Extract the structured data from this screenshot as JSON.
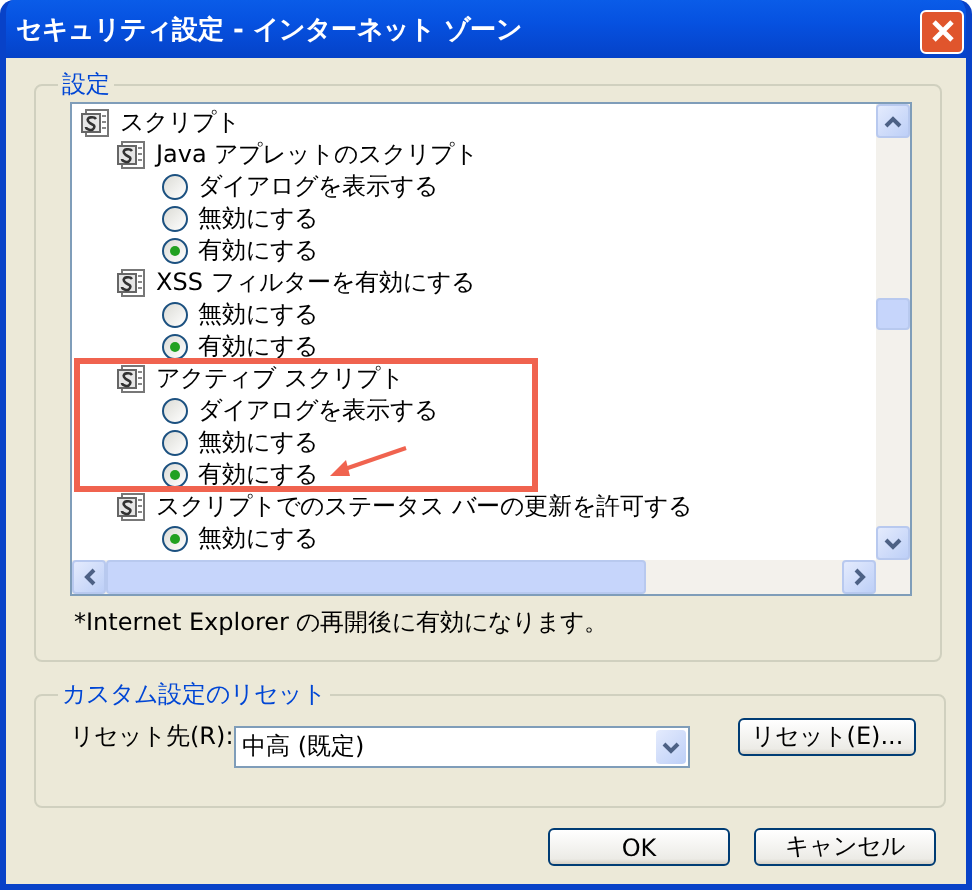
{
  "window": {
    "title": "セキュリティ設定 - インターネット ゾーン"
  },
  "settings_group": {
    "label": "設定",
    "tree": [
      {
        "label": "スクリプト",
        "children": [
          {
            "label": "Java アプレットのスクリプト",
            "highlighted": false,
            "options": [
              {
                "label": "ダイアログを表示する",
                "selected": false
              },
              {
                "label": "無効にする",
                "selected": false
              },
              {
                "label": "有効にする",
                "selected": true
              }
            ]
          },
          {
            "label": "XSS フィルターを有効にする",
            "highlighted": false,
            "options": [
              {
                "label": "無効にする",
                "selected": false
              },
              {
                "label": "有効にする",
                "selected": true
              }
            ]
          },
          {
            "label": "アクティブ スクリプト",
            "highlighted": true,
            "options": [
              {
                "label": "ダイアログを表示する",
                "selected": false
              },
              {
                "label": "無効にする",
                "selected": false
              },
              {
                "label": "有効にする",
                "selected": true
              }
            ]
          },
          {
            "label": "スクリプトでのステータス バーの更新を許可する",
            "highlighted": false,
            "options": [
              {
                "label": "無効にする",
                "selected": true
              }
            ]
          }
        ]
      }
    ],
    "note": "*Internet Explorer の再開後に有効になります。"
  },
  "reset_group": {
    "label": "カスタム設定のリセット",
    "reset_to_label": "リセット先(R):",
    "reset_to_value": "中高 (既定)",
    "reset_button": "リセット(E)..."
  },
  "buttons": [
    "OK",
    "キャンセル"
  ]
}
